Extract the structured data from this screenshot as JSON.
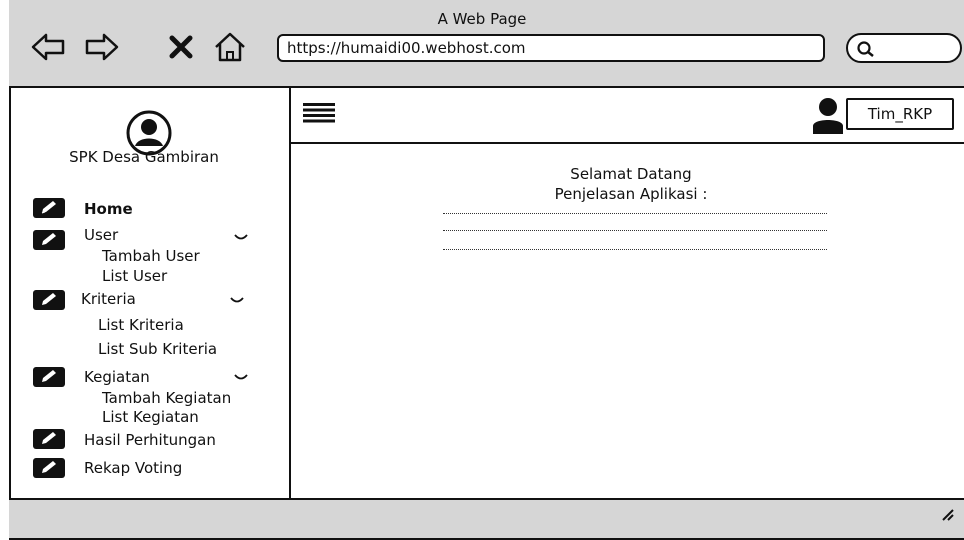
{
  "window": {
    "title": "A Web Page"
  },
  "browser": {
    "back_icon": "arrow-left-icon",
    "forward_icon": "arrow-right-icon",
    "close_icon": "x-icon",
    "home_icon": "home-icon",
    "url": "https://humaidi00.webhost.com",
    "search_icon": "search-icon"
  },
  "sidebar": {
    "brand": "SPK Desa Gambiran",
    "items": [
      {
        "label": "Home",
        "bold": true
      },
      {
        "label": "User",
        "expandable": true,
        "children": [
          "Tambah User",
          "List User"
        ]
      },
      {
        "label": "Kriteria",
        "expandable": true,
        "children": [
          "List Kriteria",
          "List Sub Kriteria"
        ]
      },
      {
        "label": "Kegiatan",
        "expandable": true,
        "children": [
          "Tambah Kegiatan",
          "List Kegiatan"
        ]
      },
      {
        "label": "Hasil Perhitungan"
      },
      {
        "label": "Rekap Voting"
      }
    ]
  },
  "topbar": {
    "user_label": "Tim_RKP"
  },
  "main": {
    "welcome_line1": "Selamat Datang",
    "welcome_line2": "Penjelasan Aplikasi :"
  }
}
